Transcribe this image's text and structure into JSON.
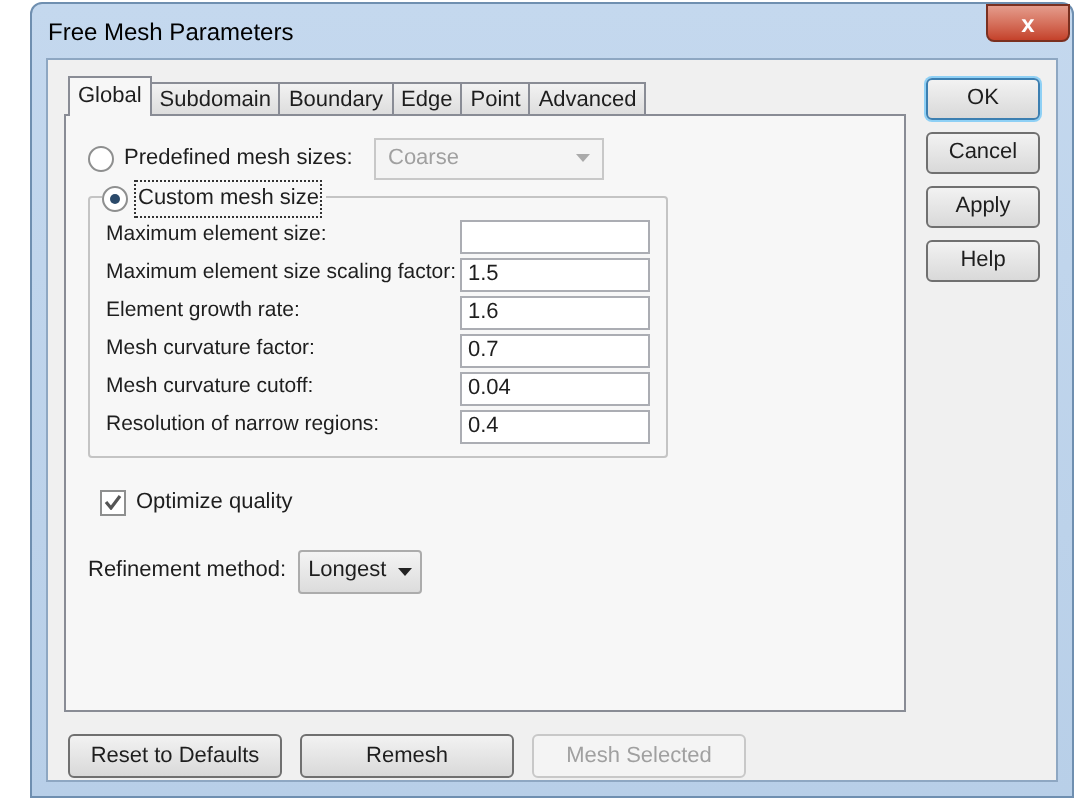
{
  "window": {
    "title": "Free Mesh Parameters",
    "close": "x"
  },
  "tabs": [
    {
      "label": "Global",
      "selected": true
    },
    {
      "label": "Subdomain",
      "selected": false
    },
    {
      "label": "Boundary",
      "selected": false
    },
    {
      "label": "Edge",
      "selected": false
    },
    {
      "label": "Point",
      "selected": false
    },
    {
      "label": "Advanced",
      "selected": false
    }
  ],
  "predefined": {
    "label": "Predefined mesh sizes:",
    "selected": false,
    "dropdown": {
      "value": "Coarse",
      "disabled": true
    }
  },
  "custom": {
    "label": "Custom mesh size",
    "selected": true,
    "fields": [
      {
        "label": "Maximum element size:"
      },
      {
        "label": "Maximum element size scaling factor:",
        "value": "1.5"
      },
      {
        "label": "Element growth rate:",
        "value": "1.6"
      },
      {
        "label": "Mesh curvature factor:",
        "value": "0.7"
      },
      {
        "label": "Mesh curvature cutoff:",
        "value": "0.04"
      },
      {
        "label": "Resolution of narrow regions:",
        "value": "0.4"
      }
    ]
  },
  "optimize": {
    "label": "Optimize quality",
    "checked": true
  },
  "refinement": {
    "label": "Refinement method:",
    "value": "Longest"
  },
  "side_buttons": [
    {
      "label": "OK",
      "default": true
    },
    {
      "label": "Cancel",
      "default": false
    },
    {
      "label": "Apply",
      "default": false
    },
    {
      "label": "Help",
      "default": false
    }
  ],
  "bottom_buttons": [
    {
      "label": "Reset to Defaults",
      "disabled": false
    },
    {
      "label": "Remesh",
      "disabled": false
    },
    {
      "label": "Mesh Selected",
      "disabled": true
    }
  ]
}
